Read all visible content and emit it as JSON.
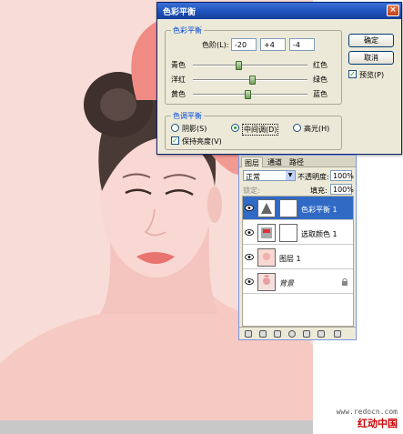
{
  "dialog": {
    "title": "色彩平衡",
    "close_glyph": "×",
    "group1_title": "色彩平衡",
    "levels_label": "色阶(L):",
    "levels": [
      "-20",
      "+4",
      "-4"
    ],
    "sliders": [
      {
        "left": "青色",
        "right": "红色",
        "value": -20
      },
      {
        "left": "洋红",
        "right": "绿色",
        "value": 4
      },
      {
        "left": "黄色",
        "right": "蓝色",
        "value": -4
      }
    ],
    "group2_title": "色调平衡",
    "tones": {
      "shadows": "阴影(S)",
      "midtones": "中间调(D)",
      "highlights": "高光(H)",
      "selected": "midtones"
    },
    "preserve_luminosity": "保持亮度(V)",
    "preserve_checked": true,
    "ok": "确定",
    "cancel": "取消",
    "preview": "预览(P)",
    "preview_checked": true,
    "check_glyph": "✓"
  },
  "layers": {
    "tabs": [
      "图层",
      "通道",
      "路径"
    ],
    "blend_mode": "正常",
    "opacity_label": "不透明度:",
    "opacity": "100%",
    "lock_label": "锁定:",
    "fill_label": "填充:",
    "fill": "100%",
    "rows": [
      {
        "name": "色彩平衡 1",
        "selected": true
      },
      {
        "name": "选取颜色 1",
        "selected": false
      },
      {
        "name": "图层 1",
        "selected": false
      },
      {
        "name": "背景",
        "selected": false
      }
    ]
  },
  "watermark": {
    "url": "www.redocn.com",
    "site": "红动中国"
  },
  "colors": {
    "accent": "#316ac5",
    "title_bar": "#1c4fb8",
    "photo_tint": "#f7d4cf"
  }
}
